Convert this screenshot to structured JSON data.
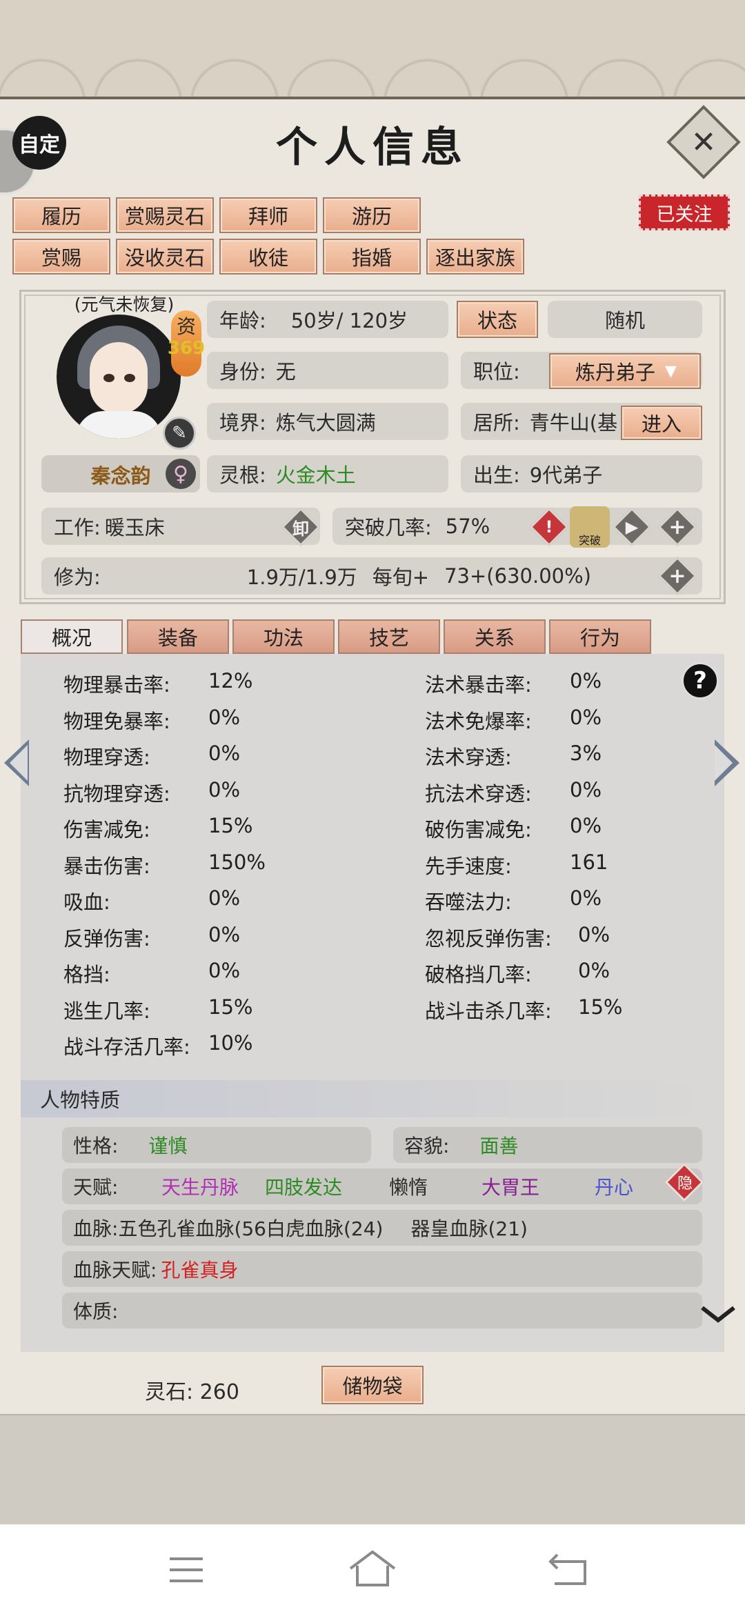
{
  "header": {
    "title": "个人信息",
    "custom_label": "自定",
    "close_label": "✕"
  },
  "action_buttons": {
    "row1": [
      "履历",
      "赏赐灵石",
      "拜师",
      "游历"
    ],
    "row2": [
      "赏赐",
      "没收灵石",
      "收徒",
      "指婚",
      "逐出家族"
    ]
  },
  "followed_label": "已关注",
  "character": {
    "status_note": "(元气未恢复)",
    "aptitude_label": "资",
    "aptitude_value": "369",
    "name": "秦念韵",
    "age_label": "年龄:",
    "age_value": "50岁/ 120岁",
    "status_button": "状态",
    "random_button": "随机",
    "identity_label": "身份:",
    "identity_value": "无",
    "position_label": "职位:",
    "position_value": "炼丹弟子",
    "realm_label": "境界:",
    "realm_value": "炼气大圆满",
    "residence_label": "居所:",
    "residence_value": "青牛山(基",
    "enter_button": "进入",
    "root_label": "灵根:",
    "root_value": "火金木土",
    "birth_label": "出生:",
    "birth_value": "9代弟子",
    "job_label": "工作:",
    "job_value": "暖玉床",
    "unequip_label": "卸",
    "breakthrough_label": "突破几率:",
    "breakthrough_value": "57%",
    "breakthrough_icon_label": "突破",
    "cultivation_label": "修为:",
    "cultivation_value": "1.9万/1.9万",
    "per_period_label": "每旬+",
    "per_period_value": "73+(630.00%)"
  },
  "tabs": [
    "概况",
    "装备",
    "功法",
    "技艺",
    "关系",
    "行为"
  ],
  "stats_left": [
    {
      "label": "物理暴击率:",
      "value": "12%"
    },
    {
      "label": "物理免暴率:",
      "value": "0%"
    },
    {
      "label": "物理穿透:",
      "value": "0%"
    },
    {
      "label": "抗物理穿透:",
      "value": "0%"
    },
    {
      "label": "伤害减免:",
      "value": "15%"
    },
    {
      "label": "暴击伤害:",
      "value": "150%"
    },
    {
      "label": "吸血:",
      "value": "0%"
    },
    {
      "label": "反弹伤害:",
      "value": "0%"
    },
    {
      "label": "格挡:",
      "value": "0%"
    },
    {
      "label": "逃生几率:",
      "value": "15%"
    },
    {
      "label": "战斗存活几率:",
      "value": "10%"
    }
  ],
  "stats_right": [
    {
      "label": "法术暴击率:",
      "value": "0%"
    },
    {
      "label": "法术免爆率:",
      "value": "0%"
    },
    {
      "label": "法术穿透:",
      "value": "3%"
    },
    {
      "label": "抗法术穿透:",
      "value": "0%"
    },
    {
      "label": "破伤害减免:",
      "value": "0%"
    },
    {
      "label": "先手速度:",
      "value": "161"
    },
    {
      "label": "吞噬法力:",
      "value": "0%"
    },
    {
      "label": "忽视反弹伤害:",
      "value": "0%"
    },
    {
      "label": "破格挡几率:",
      "value": "0%"
    },
    {
      "label": "战斗击杀几率:",
      "value": "15%"
    }
  ],
  "traits": {
    "header": "人物特质",
    "personality_label": "性格:",
    "personality_value": "谨慎",
    "appearance_label": "容貌:",
    "appearance_value": "面善",
    "talent_label": "天赋:",
    "talents": [
      "天生丹脉",
      "四肢发达",
      "懒惰",
      "大胃王",
      "丹心"
    ],
    "hide_label": "隐",
    "bloodline_label": "血脉:",
    "bloodline_value": "五色孔雀血脉(56白虎血脉(24)",
    "bloodline_value2": "器皇血脉(21)",
    "bloodline_talent_label": "血脉天赋:",
    "bloodline_talent_value": "孔雀真身",
    "physique_label": "体质:"
  },
  "footer": {
    "spirit_stone_label": "灵石:",
    "spirit_stone_value": "260",
    "storage_button": "储物袋"
  },
  "nav": {
    "menu": "☰",
    "home": "⌂",
    "back": "↩"
  },
  "colors": {
    "accent_button": "#e9ae8d",
    "followed_red": "#c8262b",
    "green_text": "#2e8b24",
    "talent_magenta": "#b230b2",
    "talent_blue": "#4a52cc",
    "bloodline_red": "#d42020"
  }
}
